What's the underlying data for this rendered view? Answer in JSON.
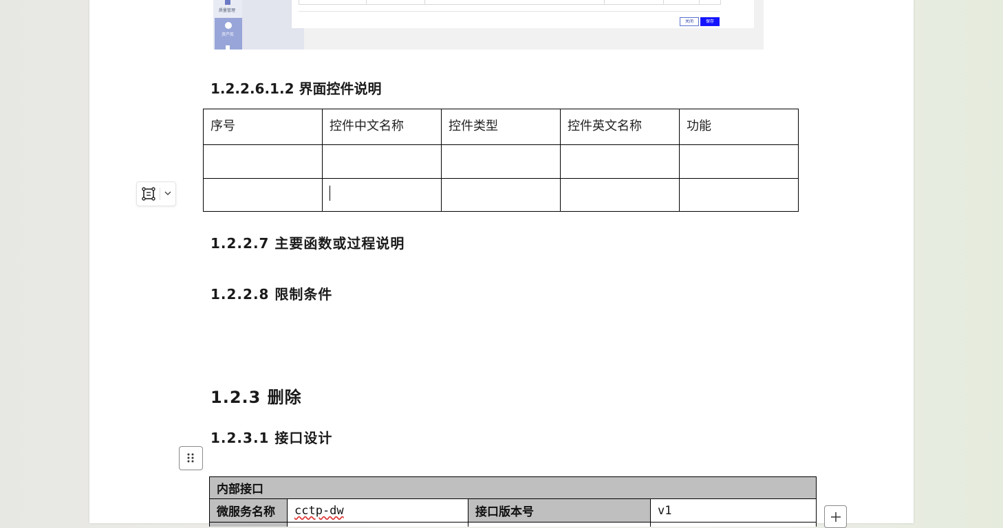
{
  "embedded_screenshot": {
    "nav": [
      {
        "label": "质量管理"
      },
      {
        "label": "资产库"
      }
    ],
    "buttons": {
      "close_label": "关闭",
      "save_label": "保存"
    },
    "colors": {
      "save_bg": "#1414ff",
      "nav_blue": "#98a5d8"
    }
  },
  "headings": {
    "controls": "1.2.2.6.1.2 界面控件说明",
    "functions": "1.2.2.7 主要函数或过程说明",
    "limits": "1.2.2.8 限制条件",
    "delete": "1.2.3 删除",
    "interface": "1.2.3.1 接口设计"
  },
  "control_table": {
    "columns": [
      "序号",
      "控件中文名称",
      "控件类型",
      "控件英文名称",
      "功能"
    ],
    "rows": [
      [
        "",
        "",
        "",
        "",
        ""
      ],
      [
        "",
        "",
        "",
        "",
        ""
      ]
    ]
  },
  "interface_table": {
    "title": "内部接口",
    "service_label": "微服务名称",
    "service_value": "cctp-dw",
    "version_label": "接口版本号",
    "version_value": "v1"
  },
  "icons": {
    "floating_control": "frame-icon",
    "floating_chevron": "chevron-down-icon",
    "drag_handle": "drag-handle-icon",
    "add": "plus-icon"
  }
}
